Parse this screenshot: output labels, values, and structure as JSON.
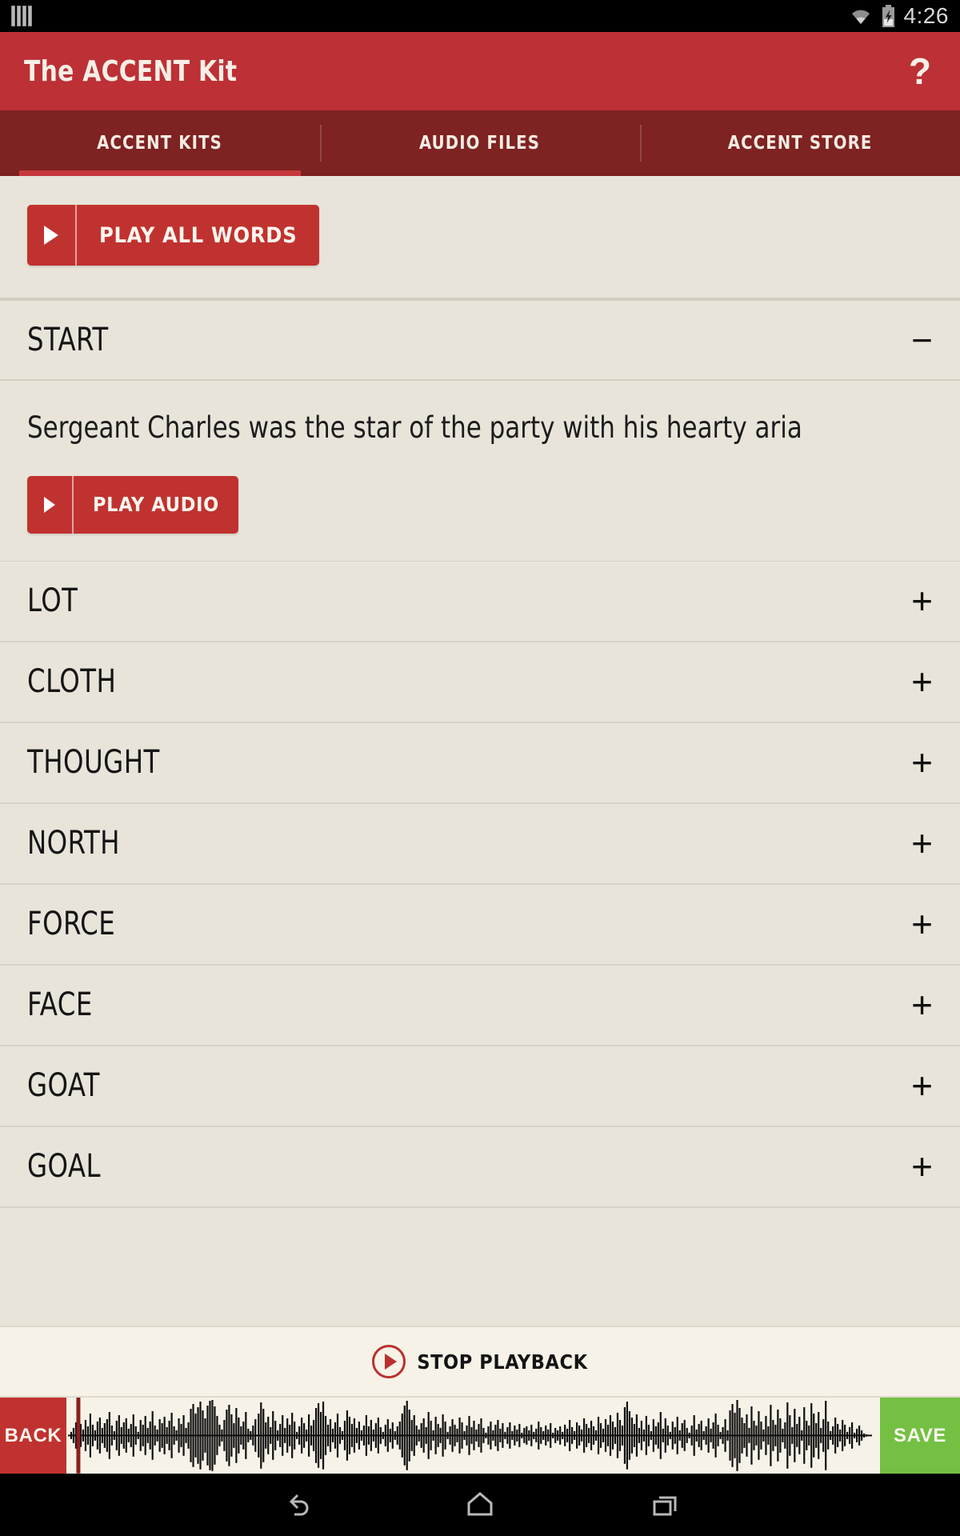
{
  "status_bar": {
    "time": "4:26",
    "icons": [
      "signal-bars-icon",
      "wifi-icon",
      "battery-charging-icon"
    ]
  },
  "app_bar": {
    "title": "The ACCENT Kit",
    "help_label": "?"
  },
  "tabs": [
    {
      "label": "ACCENT KITS",
      "active": true
    },
    {
      "label": "AUDIO FILES",
      "active": false
    },
    {
      "label": "ACCENT STORE",
      "active": false
    }
  ],
  "toolbar": {
    "play_all_label": "PLAY ALL WORDS"
  },
  "expanded_section": {
    "title": "START",
    "toggle_glyph": "−",
    "sentence": "Sergeant Charles was the star of the party with his hearty aria",
    "play_audio_label": "PLAY AUDIO"
  },
  "word_rows": [
    {
      "label": "LOT",
      "toggle_glyph": "+"
    },
    {
      "label": "CLOTH",
      "toggle_glyph": "+"
    },
    {
      "label": "THOUGHT",
      "toggle_glyph": "+"
    },
    {
      "label": "NORTH",
      "toggle_glyph": "+"
    },
    {
      "label": "FORCE",
      "toggle_glyph": "+"
    },
    {
      "label": "FACE",
      "toggle_glyph": "+"
    },
    {
      "label": "GOAT",
      "toggle_glyph": "+"
    },
    {
      "label": "GOAL",
      "toggle_glyph": "+"
    }
  ],
  "playback_bar": {
    "label": "STOP PLAYBACK"
  },
  "wave_bar": {
    "back_label": "BACK",
    "save_label": "SAVE"
  },
  "nav_bar": {
    "items": [
      "back-nav-icon",
      "home-nav-icon",
      "recents-nav-icon"
    ]
  },
  "colors": {
    "brand_red": "#bc3036",
    "tab_red": "#7e2222",
    "button_red": "#c0322f",
    "save_green": "#74c043",
    "page_bg": "#e8e4da",
    "footer_bg": "#f7f2e7"
  }
}
